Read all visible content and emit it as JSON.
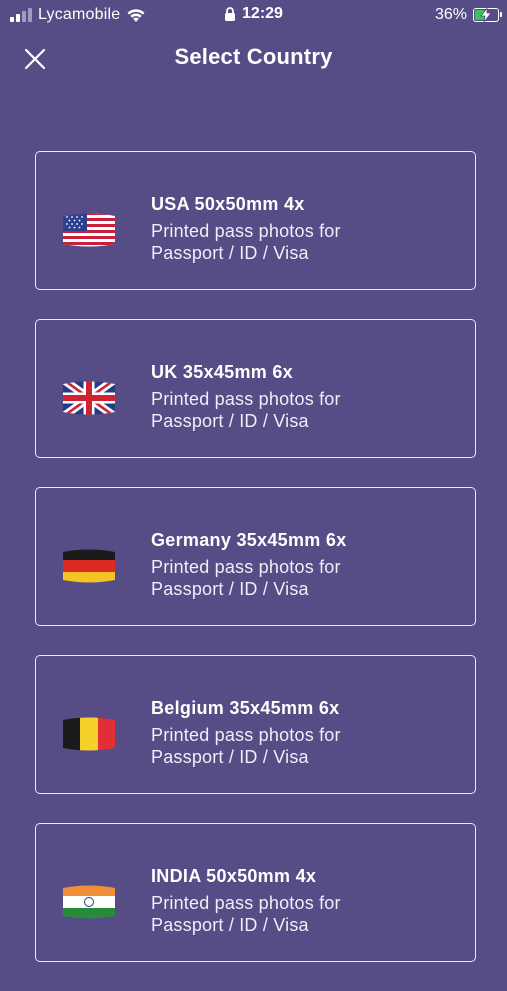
{
  "status_bar": {
    "carrier": "Lycamobile",
    "time": "12:29",
    "battery": "36%",
    "battery_level": 0.36
  },
  "nav": {
    "title": "Select Country",
    "close_icon": "close-icon"
  },
  "countries": [
    {
      "title": "USA 50x50mm 4x",
      "line1": "Printed pass photos for",
      "line2": "Passport / ID / Visa",
      "flag": "usa-flag-icon"
    },
    {
      "title": "UK 35x45mm 6x",
      "line1": "Printed pass photos for",
      "line2": "Passport / ID / Visa",
      "flag": "uk-flag-icon"
    },
    {
      "title": "Germany 35x45mm 6x",
      "line1": "Printed pass photos for",
      "line2": "Passport / ID / Visa",
      "flag": "germany-flag-icon"
    },
    {
      "title": "Belgium 35x45mm 6x",
      "line1": "Printed pass photos for",
      "line2": "Passport / ID / Visa",
      "flag": "belgium-flag-icon"
    },
    {
      "title": "INDIA 50x50mm 4x",
      "line1": "Printed pass photos for",
      "line2": "Passport / ID / Visa",
      "flag": "india-flag-icon"
    }
  ],
  "colors": {
    "background": "#564c86",
    "card_border": "#ffffff",
    "battery_fill": "#35c759"
  }
}
